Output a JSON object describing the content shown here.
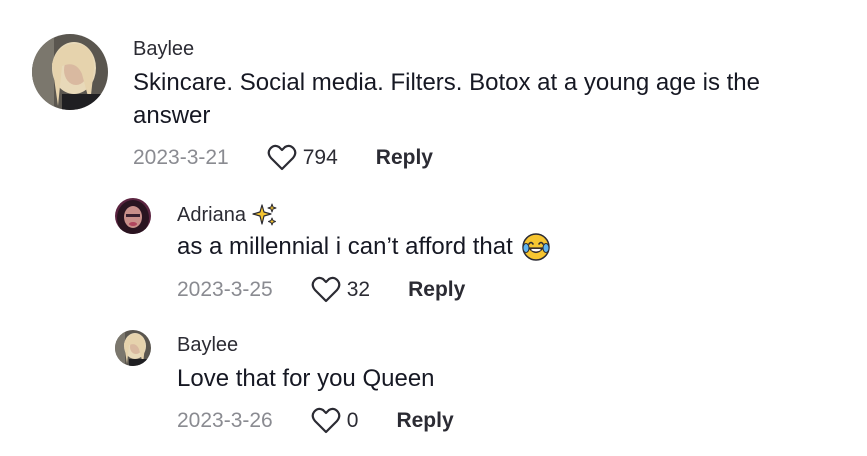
{
  "comments": [
    {
      "username": "Baylee",
      "text": "Skincare. Social media. Filters. Botox at a young age is the answer",
      "date": "2023-3-21",
      "likes": "794",
      "reply_label": "Reply",
      "avatar_icon": "profile-photo-blonde"
    },
    {
      "username": "Adriana",
      "badge_icon": "sparkles-emoji",
      "text": "as a millennial i can’t afford that",
      "text_emoji": "tears-of-joy-emoji",
      "date": "2023-3-25",
      "likes": "32",
      "reply_label": "Reply",
      "avatar_icon": "profile-photo-dark-hair"
    },
    {
      "username": "Baylee",
      "text": "Love that for you Queen",
      "date": "2023-3-26",
      "likes": "0",
      "reply_label": "Reply",
      "avatar_icon": "profile-photo-blonde"
    }
  ],
  "colors": {
    "primary_text": "#161823",
    "secondary_text": "#8a8b91",
    "username": "#2b2b33"
  }
}
